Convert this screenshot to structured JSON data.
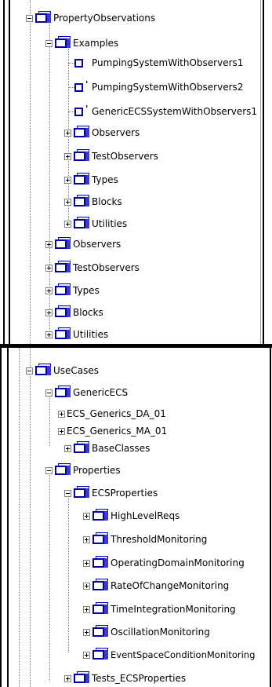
{
  "tree_top": {
    "root": "PropertyObservations",
    "examples": {
      "label": "Examples",
      "diagrams": [
        {
          "label": "PumpingSystemWithObservers1",
          "modified": false
        },
        {
          "label": "PumpingSystemWithObservers2",
          "modified": true
        },
        {
          "label": "GenericECSSystemWithObservers1",
          "modified": true
        }
      ],
      "packages": [
        "Observers",
        "TestObservers",
        "Types",
        "Blocks",
        "Utilities"
      ]
    },
    "packages": [
      "Observers",
      "TestObservers",
      "Types",
      "Blocks",
      "Utilities"
    ]
  },
  "tree_bottom": {
    "root": "UseCases",
    "generic_ecs": {
      "label": "GenericECS",
      "children": [
        "ECS_Generics_DA_01",
        "ECS_Generics_MA_01"
      ],
      "base_classes": "BaseClasses"
    },
    "properties": {
      "label": "Properties",
      "ecs_properties": {
        "label": "ECSProperties",
        "children": [
          "HighLevelReqs",
          "ThresholdMonitoring",
          "OperatingDomainMonitoring",
          "RateOfChangeMonitoring",
          "TimeIntegrationMonitoring",
          "OscillationMonitoring",
          "EventSpaceConditionMonitoring"
        ]
      },
      "tests": "Tests_ECSProperties"
    }
  }
}
